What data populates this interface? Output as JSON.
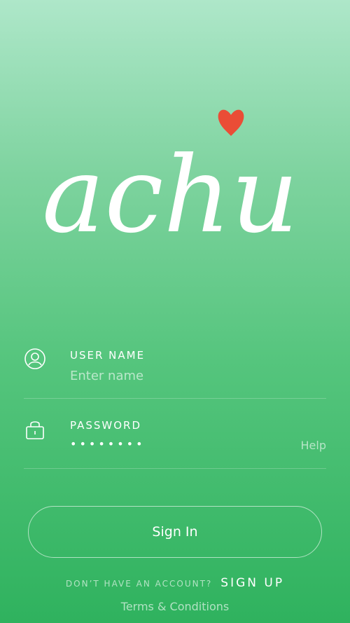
{
  "logo": {
    "text": "achu",
    "heart_color": "#ea4d36"
  },
  "username": {
    "label": "USER NAME",
    "placeholder": "Enter name",
    "icon": "user-circle-icon"
  },
  "password": {
    "label": "PASSWORD",
    "masked_value": "••••••••",
    "help_label": "Help",
    "icon": "lock-icon"
  },
  "sign_in_label": "Sign In",
  "account": {
    "prompt": "DON’T HAVE AN ACCOUNT?",
    "sign_up_label": "SIGN UP"
  },
  "terms_label": "Terms & Conditions"
}
